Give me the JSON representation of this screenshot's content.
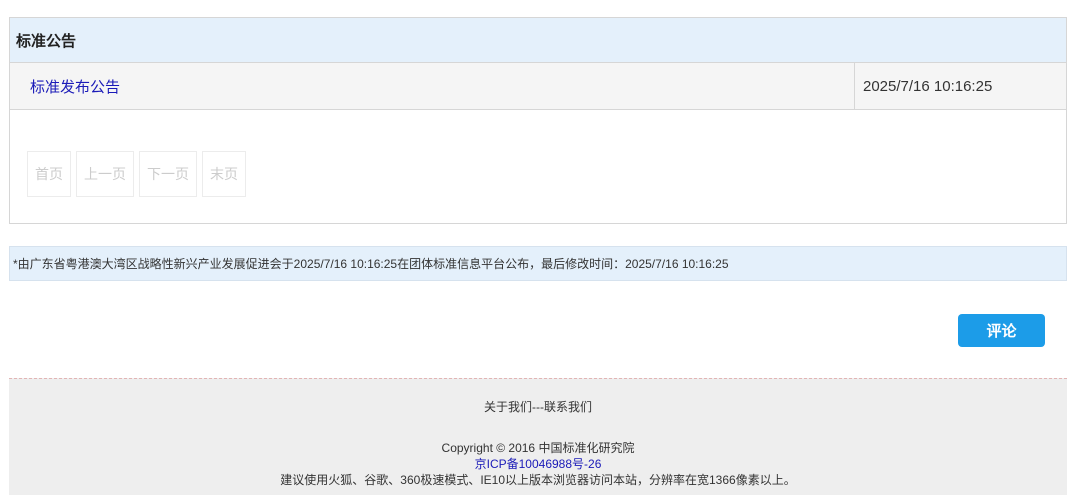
{
  "panel": {
    "title": "标准公告",
    "notice": {
      "title": "标准发布公告",
      "time": "2025/7/16 10:16:25"
    },
    "pager": {
      "first": "首页",
      "prev": "上一页",
      "next": "下一页",
      "last": "末页"
    }
  },
  "info_bar": {
    "text": "*由广东省粤港澳大湾区战略性新兴产业发展促进会于2025/7/16 10:16:25在团体标准信息平台公布，最后修改时间：2025/7/16 10:16:25"
  },
  "comment_button": {
    "label": "评论"
  },
  "footer": {
    "about": "关于我们",
    "separator": "---",
    "contact": "联系我们",
    "copyright": "Copyright © 2016 中国标准化研究院",
    "icp": "京ICP备10046988号-26",
    "tip": "建议使用火狐、谷歌、360极速模式、IE10以上版本浏览器访问本站，分辨率在宽1366像素以上。"
  },
  "colors": {
    "header_bg": "#e4f0fb",
    "link": "#1a1ab8",
    "button": "#1c9ce8",
    "footer_bg": "#eeeeee"
  }
}
